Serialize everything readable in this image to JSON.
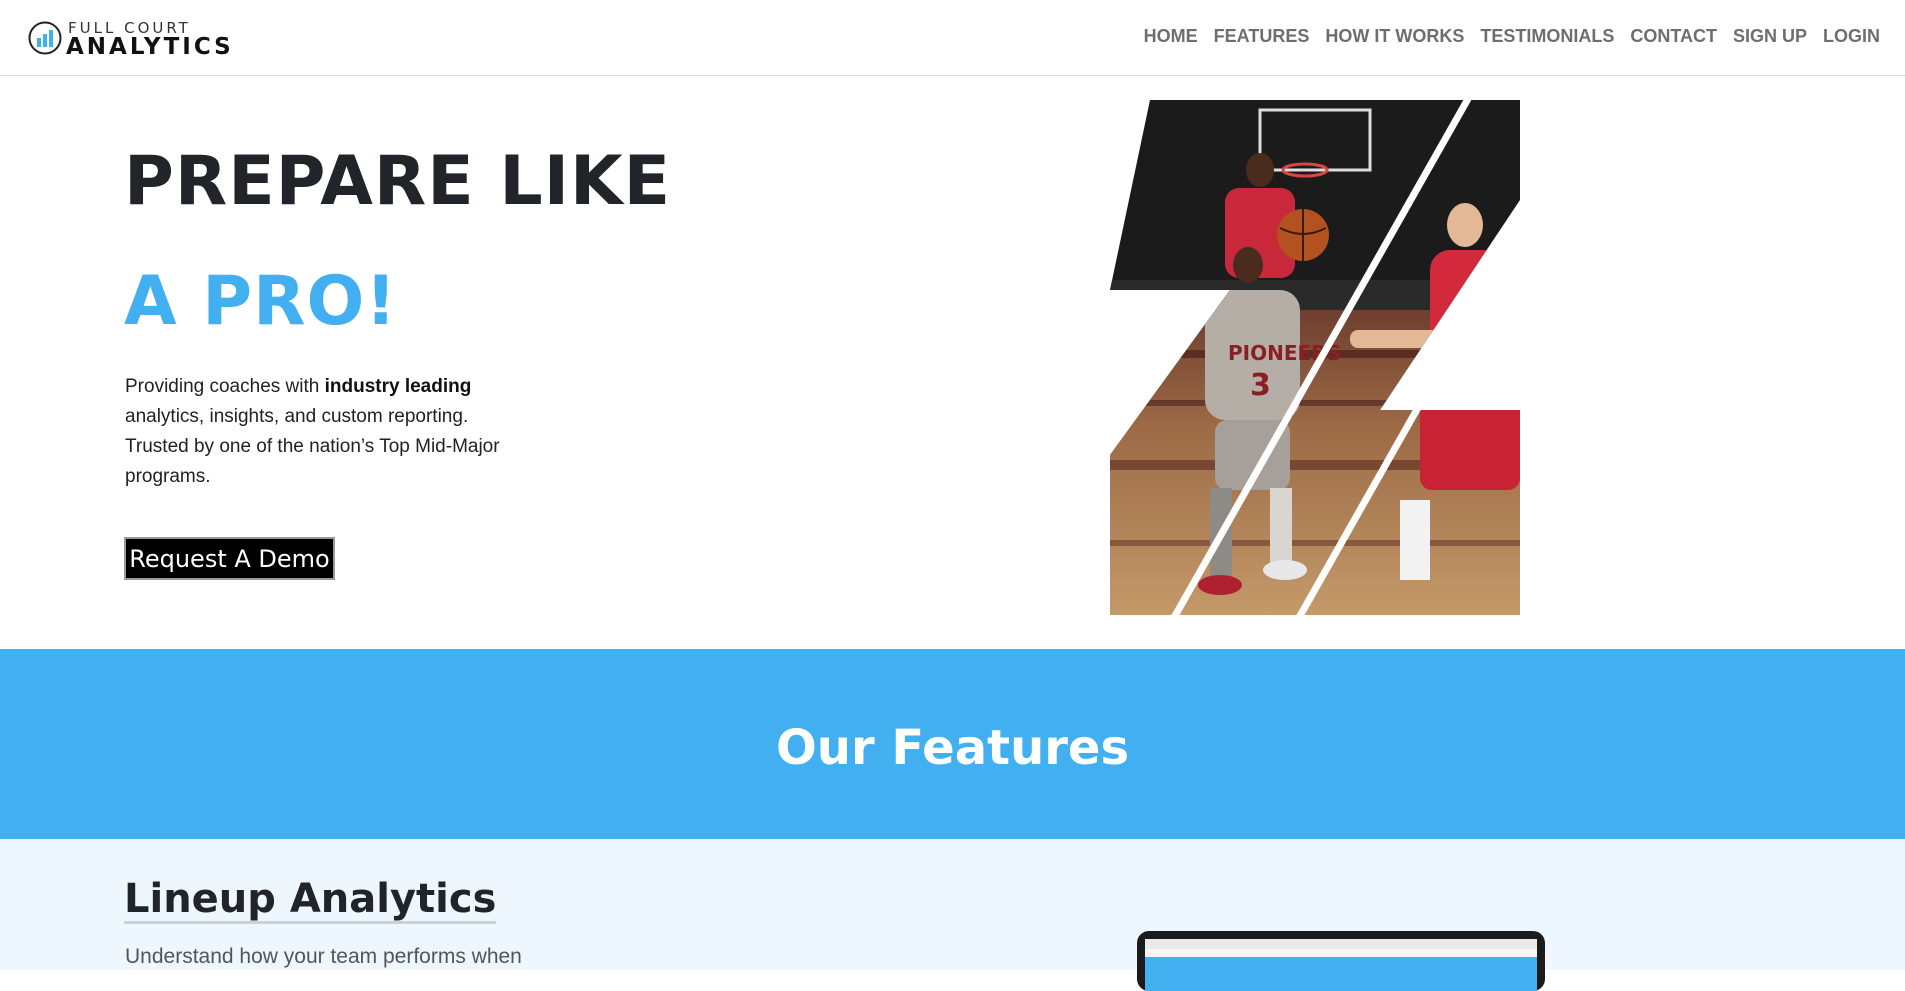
{
  "brand": {
    "name_top": "FULL COURT",
    "name_bottom": "ANALYTICS",
    "accent_color": "#42aff0"
  },
  "nav": {
    "items": [
      "HOME",
      "FEATURES",
      "HOW IT WORKS",
      "TESTIMONIALS",
      "CONTACT",
      "SIGN UP",
      "LOGIN"
    ]
  },
  "hero": {
    "title_line1": "PREPARE LIKE",
    "title_line2": "A PRO!",
    "desc_prefix": "Providing coaches with ",
    "desc_bold": "industry leading",
    "desc_suffix": " analytics, insights, and custom reporting. Trusted by one of the nation’s Top Mid-Major programs.",
    "cta_label": "Request A Demo",
    "image_icon": "basketball-players-photo"
  },
  "features": {
    "section_title": "Our Features",
    "items": [
      {
        "heading": "Lineup Analytics",
        "description": "Understand how your team performs when",
        "image_icon": "laptop-screenshot"
      }
    ]
  }
}
